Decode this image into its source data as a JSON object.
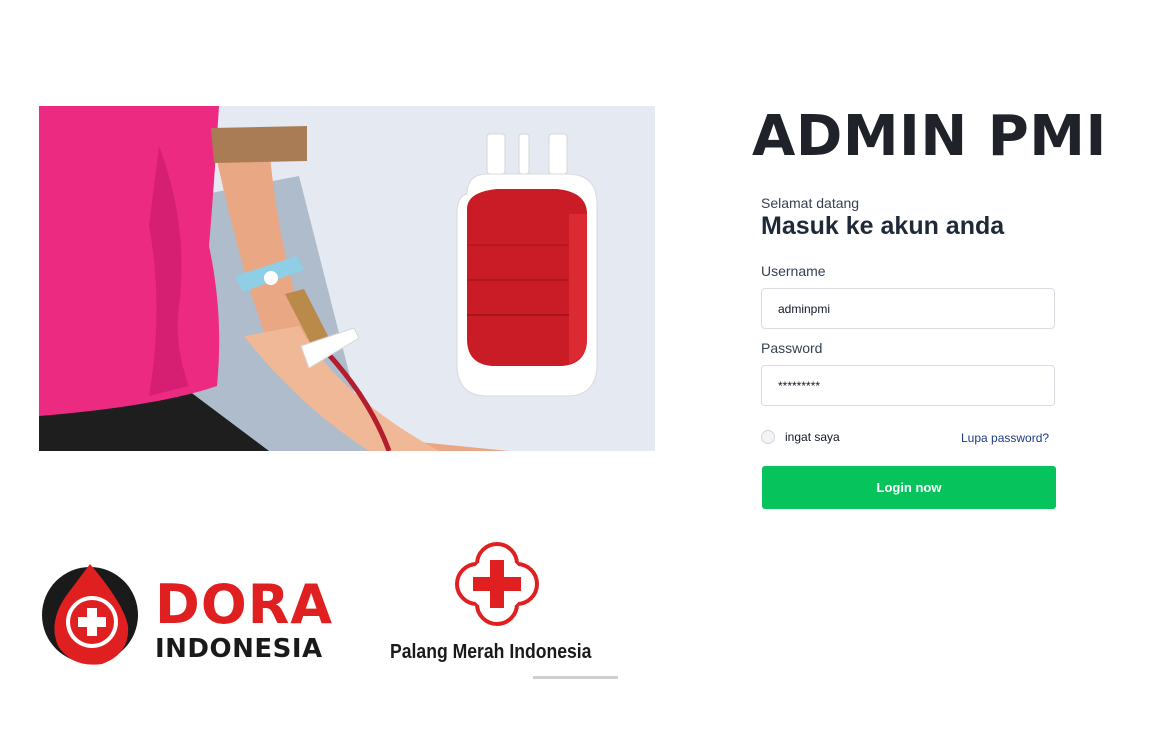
{
  "page": {
    "title": "ADMIN PMI"
  },
  "form": {
    "welcome": "Selamat datang",
    "heading": "Masuk ke akun anda",
    "username_label": "Username",
    "username_value": "adminpmi",
    "password_label": "Password",
    "password_value": "*********",
    "remember_label": "ingat saya",
    "forgot_label": "Lupa password?",
    "login_label": "Login now"
  },
  "logos": {
    "dora_primary": "DORA",
    "dora_secondary": "INDONESIA",
    "pmi_name": "Palang Merah Indonesia"
  },
  "colors": {
    "accent_green": "#06c35c",
    "brand_red": "#e02020",
    "title_dark": "#1f2329"
  },
  "icons": {
    "hero": "blood-donation-illustration",
    "dora": "blood-drop-cross-icon",
    "pmi": "red-cross-flower-icon"
  }
}
